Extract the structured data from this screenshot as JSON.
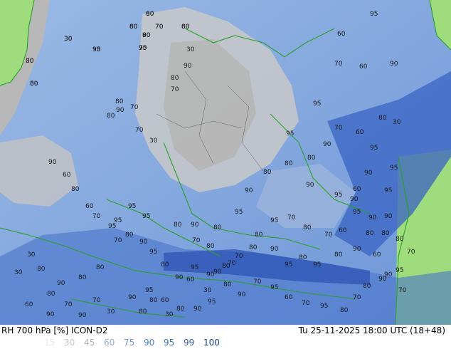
{
  "header": {
    "product": "RH 700 hPa [%] ICON-D2",
    "valid_time": "Tu 25-11-2025 18:00 UTC (18+48)"
  },
  "legend": {
    "values": [
      "15",
      "30",
      "45",
      "60",
      "75",
      "90",
      "95",
      "99",
      "100"
    ],
    "colors": [
      "#e8e8e8",
      "#c8c8c8",
      "#b4b4b4",
      "#8fb3de",
      "#6f9ad6",
      "#4f7fcf",
      "#3f6fcc",
      "#2f58c0",
      "#1a3fa8"
    ]
  },
  "colors": {
    "outside_domain_land": "#9fdc7c",
    "outside_domain_sea": "#b8b8b8",
    "borders": "#2aa02a"
  },
  "contour_labels": [
    {
      "t": "60"
    },
    {
      "t": "30"
    },
    {
      "t": "30"
    },
    {
      "t": "30"
    },
    {
      "t": "80"
    },
    {
      "t": "70"
    },
    {
      "t": "30"
    },
    {
      "t": "60"
    },
    {
      "t": "70"
    },
    {
      "t": "80"
    },
    {
      "t": "30"
    },
    {
      "t": "90"
    },
    {
      "t": "80"
    },
    {
      "t": "70"
    },
    {
      "t": "80"
    },
    {
      "t": "70"
    },
    {
      "t": "90"
    },
    {
      "t": "80"
    },
    {
      "t": "70"
    },
    {
      "t": "30"
    },
    {
      "t": "60"
    },
    {
      "t": "80"
    },
    {
      "t": "90"
    },
    {
      "t": "60"
    },
    {
      "t": "70"
    },
    {
      "t": "95"
    },
    {
      "t": "70"
    },
    {
      "t": "80"
    },
    {
      "t": "80"
    },
    {
      "t": "90"
    },
    {
      "t": "30"
    },
    {
      "t": "80"
    },
    {
      "t": "80"
    },
    {
      "t": "30"
    },
    {
      "t": "60"
    },
    {
      "t": "90"
    },
    {
      "t": "70"
    },
    {
      "t": "90"
    },
    {
      "t": "70"
    },
    {
      "t": "30"
    },
    {
      "t": "90"
    },
    {
      "t": "80"
    },
    {
      "t": "80"
    },
    {
      "t": "30"
    },
    {
      "t": "70"
    },
    {
      "t": "80"
    },
    {
      "t": "60"
    },
    {
      "t": "30"
    },
    {
      "t": "90"
    },
    {
      "t": "70"
    },
    {
      "t": "80"
    },
    {
      "t": "90"
    },
    {
      "t": "95"
    },
    {
      "t": "80"
    },
    {
      "t": "95"
    },
    {
      "t": "80"
    },
    {
      "t": "90"
    },
    {
      "t": "80"
    },
    {
      "t": "80"
    },
    {
      "t": "60"
    },
    {
      "t": "90"
    },
    {
      "t": "70"
    },
    {
      "t": "95"
    },
    {
      "t": "90"
    },
    {
      "t": "60"
    },
    {
      "t": "95"
    },
    {
      "t": "60"
    },
    {
      "t": "70"
    },
    {
      "t": "90"
    },
    {
      "t": "80"
    },
    {
      "t": "90"
    },
    {
      "t": "95"
    },
    {
      "t": "90"
    },
    {
      "t": "60"
    },
    {
      "t": "90"
    },
    {
      "t": "30"
    },
    {
      "t": "80"
    },
    {
      "t": "95"
    },
    {
      "t": "60"
    },
    {
      "t": "95"
    },
    {
      "t": "70"
    },
    {
      "t": "95"
    },
    {
      "t": "95"
    },
    {
      "t": "80"
    },
    {
      "t": "80"
    },
    {
      "t": "90"
    },
    {
      "t": "95"
    },
    {
      "t": "80"
    },
    {
      "t": "90"
    },
    {
      "t": "80"
    },
    {
      "t": "95"
    },
    {
      "t": "95"
    },
    {
      "t": "95"
    },
    {
      "t": "80"
    },
    {
      "t": "90"
    },
    {
      "t": "95"
    },
    {
      "t": "80"
    },
    {
      "t": "90"
    },
    {
      "t": "95"
    },
    {
      "t": "90"
    },
    {
      "t": "80"
    },
    {
      "t": "70"
    },
    {
      "t": "80"
    },
    {
      "t": "95"
    },
    {
      "t": "70"
    },
    {
      "t": "80"
    },
    {
      "t": "70"
    },
    {
      "t": "60"
    },
    {
      "t": "95"
    },
    {
      "t": "90"
    },
    {
      "t": "90"
    },
    {
      "t": "80"
    },
    {
      "t": "70"
    },
    {
      "t": "95"
    },
    {
      "t": "90"
    },
    {
      "t": "80"
    },
    {
      "t": "70"
    },
    {
      "t": "80"
    },
    {
      "t": "95"
    },
    {
      "t": "70"
    },
    {
      "t": "60"
    },
    {
      "t": "95"
    },
    {
      "t": "70"
    },
    {
      "t": "90"
    },
    {
      "t": "80"
    },
    {
      "t": "95"
    },
    {
      "t": "90"
    },
    {
      "t": "80"
    },
    {
      "t": "60"
    },
    {
      "t": "95"
    },
    {
      "t": "90"
    },
    {
      "t": "30"
    },
    {
      "t": "95"
    },
    {
      "t": "80"
    },
    {
      "t": "90"
    },
    {
      "t": "95"
    },
    {
      "t": "60"
    },
    {
      "t": "80"
    },
    {
      "t": "70"
    },
    {
      "t": "60"
    }
  ]
}
